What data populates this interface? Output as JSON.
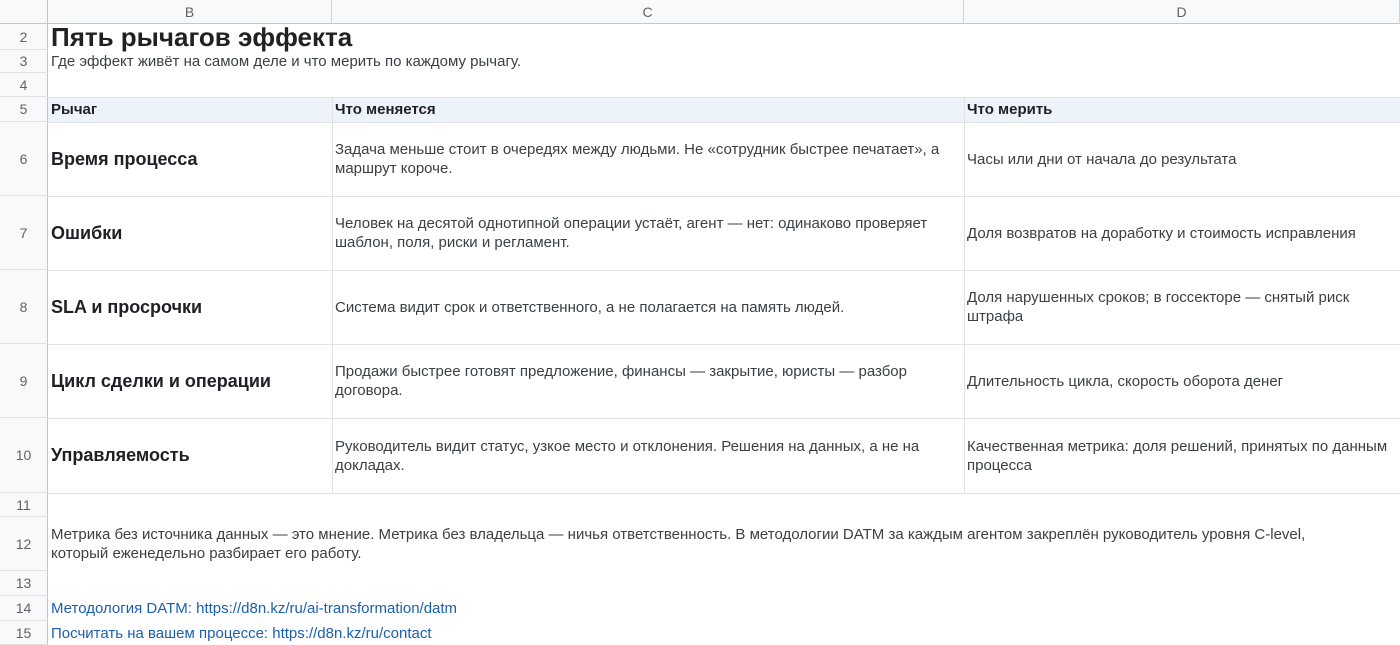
{
  "columns": [
    "B",
    "C",
    "D"
  ],
  "row_numbers": [
    "2",
    "3",
    "4",
    "5",
    "6",
    "7",
    "8",
    "9",
    "10",
    "11",
    "12",
    "13",
    "14",
    "15"
  ],
  "title": "Пять рычагов эффекта",
  "subtitle": "Где эффект живёт на самом деле и что мерить по каждому рычагу.",
  "table": {
    "headers": [
      "Рычаг",
      "Что меняется",
      "Что мерить"
    ],
    "rows": [
      {
        "lever": "Время процесса",
        "change": "Задача меньше стоит в очередях между людьми. Не «сотрудник быстрее печатает», а маршрут короче.",
        "measure": "Часы или дни от начала до результата"
      },
      {
        "lever": "Ошибки",
        "change": "Человек на десятой однотипной операции устаёт, агент — нет: одинаково проверяет шаблон, поля, риски и регламент.",
        "measure": "Доля возвратов на доработку и стоимость исправления"
      },
      {
        "lever": "SLA и просрочки",
        "change": "Система видит срок и ответственного, а не полагается на память людей.",
        "measure": "Доля нарушенных сроков; в госсекторе — снятый риск штрафа"
      },
      {
        "lever": "Цикл сделки и операции",
        "change": "Продажи быстрее готовят предложение, финансы — закрытие, юристы — разбор договора.",
        "measure": "Длительность цикла, скорость оборота денег"
      },
      {
        "lever": "Управляемость",
        "change": "Руководитель видит статус, узкое место и отклонения. Решения на данных, а не на докладах.",
        "measure": "Качественная метрика: доля решений, принятых по данным процесса"
      }
    ]
  },
  "note": "Метрика без источника данных — это мнение. Метрика без владельца — ничья ответственность. В методологии DATM за каждым агентом закреплён руководитель уровня C-level, который еженедельно разбирает его работу.",
  "links": [
    {
      "label": "Методология DATM: https://d8n.kz/ru/ai-transformation/datm"
    },
    {
      "label": "Посчитать на вашем процессе: https://d8n.kz/ru/contact"
    }
  ]
}
